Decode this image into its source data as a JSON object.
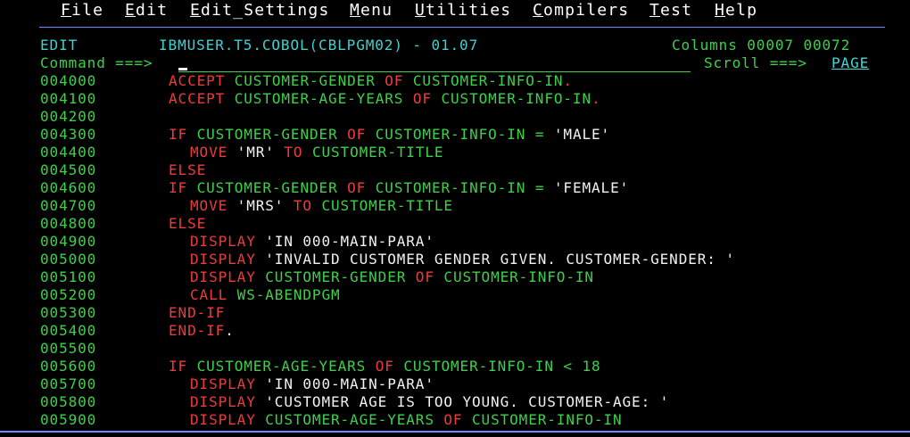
{
  "menu": {
    "items": [
      {
        "hotkey": "F",
        "rest": "ile"
      },
      {
        "hotkey": "E",
        "rest": "dit"
      },
      {
        "hotkey": "E",
        "rest": "dit_Settings"
      },
      {
        "hotkey": "M",
        "rest": "enu"
      },
      {
        "hotkey": "U",
        "rest": "tilities"
      },
      {
        "hotkey": "C",
        "rest": "ompilers"
      },
      {
        "hotkey": "T",
        "rest": "est"
      },
      {
        "hotkey": "H",
        "rest": "elp"
      }
    ]
  },
  "header": {
    "mode": "EDIT",
    "dataset": "IBMUSER.T5.COBOL(CBLPGM02) - 01.07",
    "columns_label": "Columns 00007 00072",
    "command_label": "Command ===>",
    "command_value": "",
    "scroll_label": "Scroll ===>",
    "scroll_value": "PAGE"
  },
  "colors": {
    "background": "#000000",
    "keyword": "#ee3a3a",
    "identifier": "#3ed04a",
    "literal": "#f2f2f2",
    "header": "#40d0d0",
    "rule": "#6b8cff"
  },
  "lines": [
    {
      "num": "004000",
      "indent": 6,
      "tokens": [
        {
          "t": "ACCEPT ",
          "c": "red"
        },
        {
          "t": "CUSTOMER-GENDER ",
          "c": "green"
        },
        {
          "t": "OF ",
          "c": "red"
        },
        {
          "t": "CUSTOMER-INFO-IN",
          "c": "green"
        },
        {
          "t": ".",
          "c": "red"
        }
      ]
    },
    {
      "num": "004100",
      "indent": 6,
      "tokens": [
        {
          "t": "ACCEPT ",
          "c": "red"
        },
        {
          "t": "CUSTOMER-AGE-YEARS ",
          "c": "green"
        },
        {
          "t": "OF ",
          "c": "red"
        },
        {
          "t": "CUSTOMER-INFO-IN",
          "c": "green"
        },
        {
          "t": ".",
          "c": "red"
        }
      ]
    },
    {
      "num": "004200",
      "indent": 6,
      "tokens": []
    },
    {
      "num": "004300",
      "indent": 6,
      "tokens": [
        {
          "t": "IF ",
          "c": "red"
        },
        {
          "t": "CUSTOMER-GENDER ",
          "c": "green"
        },
        {
          "t": "OF ",
          "c": "red"
        },
        {
          "t": "CUSTOMER-INFO-IN ",
          "c": "green"
        },
        {
          "t": "= ",
          "c": "green"
        },
        {
          "t": "'MALE'",
          "c": "white"
        }
      ]
    },
    {
      "num": "004400",
      "indent": 8,
      "tokens": [
        {
          "t": "MOVE ",
          "c": "red"
        },
        {
          "t": "'MR' ",
          "c": "white"
        },
        {
          "t": "TO ",
          "c": "red"
        },
        {
          "t": "CUSTOMER-TITLE",
          "c": "green"
        }
      ]
    },
    {
      "num": "004500",
      "indent": 6,
      "tokens": [
        {
          "t": "ELSE",
          "c": "red"
        }
      ]
    },
    {
      "num": "004600",
      "indent": 6,
      "tokens": [
        {
          "t": "IF ",
          "c": "red"
        },
        {
          "t": "CUSTOMER-GENDER ",
          "c": "green"
        },
        {
          "t": "OF ",
          "c": "red"
        },
        {
          "t": "CUSTOMER-INFO-IN ",
          "c": "green"
        },
        {
          "t": "= ",
          "c": "green"
        },
        {
          "t": "'FEMALE'",
          "c": "white"
        }
      ]
    },
    {
      "num": "004700",
      "indent": 8,
      "tokens": [
        {
          "t": "MOVE ",
          "c": "red"
        },
        {
          "t": "'MRS' ",
          "c": "white"
        },
        {
          "t": "TO ",
          "c": "red"
        },
        {
          "t": "CUSTOMER-TITLE",
          "c": "green"
        }
      ]
    },
    {
      "num": "004800",
      "indent": 6,
      "tokens": [
        {
          "t": "ELSE",
          "c": "red"
        }
      ]
    },
    {
      "num": "004900",
      "indent": 8,
      "tokens": [
        {
          "t": "DISPLAY ",
          "c": "red"
        },
        {
          "t": "'IN 000-MAIN-PARA'",
          "c": "white"
        }
      ]
    },
    {
      "num": "005000",
      "indent": 8,
      "tokens": [
        {
          "t": "DISPLAY ",
          "c": "red"
        },
        {
          "t": "'INVALID CUSTOMER GENDER GIVEN. CUSTOMER-GENDER: '",
          "c": "white"
        }
      ]
    },
    {
      "num": "005100",
      "indent": 8,
      "tokens": [
        {
          "t": "DISPLAY ",
          "c": "red"
        },
        {
          "t": "CUSTOMER-GENDER ",
          "c": "green"
        },
        {
          "t": "OF ",
          "c": "red"
        },
        {
          "t": "CUSTOMER-INFO-IN",
          "c": "green"
        }
      ]
    },
    {
      "num": "005200",
      "indent": 8,
      "tokens": [
        {
          "t": "CALL ",
          "c": "red"
        },
        {
          "t": "WS-ABENDPGM",
          "c": "green"
        }
      ]
    },
    {
      "num": "005300",
      "indent": 6,
      "tokens": [
        {
          "t": "END-IF",
          "c": "red"
        }
      ]
    },
    {
      "num": "005400",
      "indent": 6,
      "tokens": [
        {
          "t": "END-IF",
          "c": "red"
        },
        {
          "t": ".",
          "c": "white"
        }
      ]
    },
    {
      "num": "005500",
      "indent": 6,
      "tokens": []
    },
    {
      "num": "005600",
      "indent": 6,
      "tokens": [
        {
          "t": "IF ",
          "c": "red"
        },
        {
          "t": "CUSTOMER-AGE-YEARS ",
          "c": "green"
        },
        {
          "t": "OF ",
          "c": "red"
        },
        {
          "t": "CUSTOMER-INFO-IN ",
          "c": "green"
        },
        {
          "t": "< 18",
          "c": "green"
        }
      ]
    },
    {
      "num": "005700",
      "indent": 8,
      "tokens": [
        {
          "t": "DISPLAY ",
          "c": "red"
        },
        {
          "t": "'IN 000-MAIN-PARA'",
          "c": "white"
        }
      ]
    },
    {
      "num": "005800",
      "indent": 8,
      "tokens": [
        {
          "t": "DISPLAY ",
          "c": "red"
        },
        {
          "t": "'CUSTOMER AGE IS TOO YOUNG. CUSTOMER-AGE: '",
          "c": "white"
        }
      ]
    },
    {
      "num": "005900",
      "indent": 8,
      "tokens": [
        {
          "t": "DISPLAY ",
          "c": "red"
        },
        {
          "t": "CUSTOMER-AGE-YEARS ",
          "c": "green"
        },
        {
          "t": "OF ",
          "c": "red"
        },
        {
          "t": "CUSTOMER-INFO-IN",
          "c": "green"
        }
      ]
    }
  ]
}
